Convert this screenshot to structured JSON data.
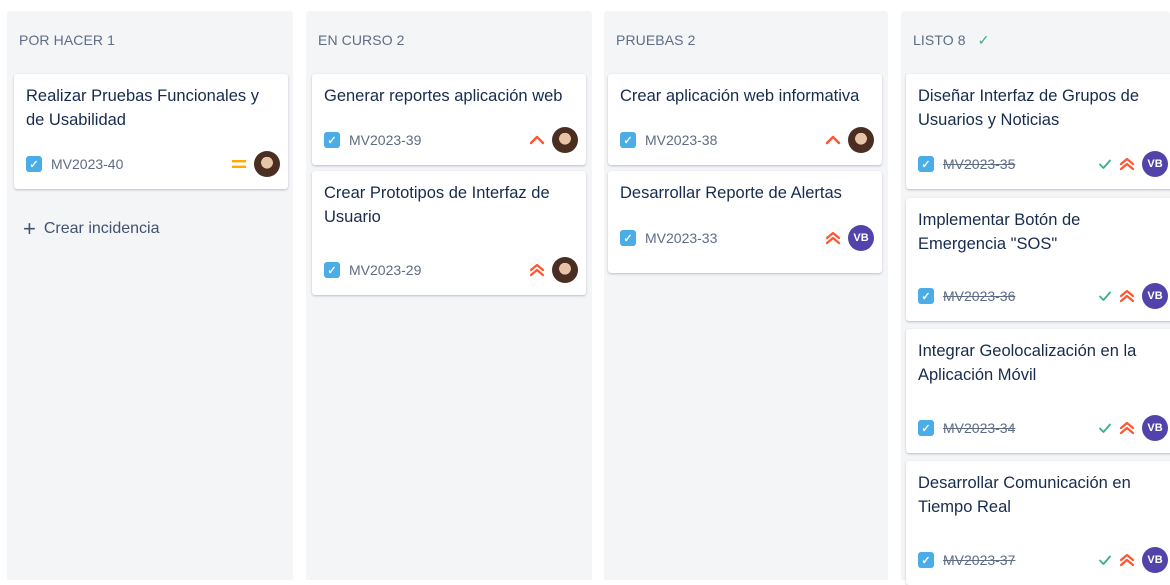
{
  "columns": [
    {
      "title": "POR HACER 1"
    },
    {
      "title": "EN CURSO 2"
    },
    {
      "title": "PRUEBAS 2"
    },
    {
      "title": "LISTO 8",
      "done_icon": "check-icon"
    }
  ],
  "create_issue": {
    "icon": "plus-icon",
    "label": "Crear incidencia"
  },
  "cards": {
    "todo": [
      {
        "title": "Realizar Pruebas Funcionales y de Usabilidad",
        "key": "MV2023-40",
        "priority": "medium",
        "assignee": "photo"
      }
    ],
    "in_progress": [
      {
        "title": "Generar reportes aplicación web",
        "key": "MV2023-39",
        "priority": "high",
        "assignee": "photo"
      },
      {
        "title": "Crear Prototipos de Interfaz de Usuario",
        "key": "MV2023-29",
        "priority": "highest",
        "assignee": "photo"
      }
    ],
    "testing": [
      {
        "title": "Crear aplicación web informativa",
        "key": "MV2023-38",
        "priority": "high",
        "assignee": "photo"
      },
      {
        "title": "Desarrollar Reporte de Alertas",
        "key": "MV2023-33",
        "priority": "highest",
        "assignee": "VB"
      }
    ],
    "done": [
      {
        "title": "Diseñar Interfaz de Grupos de Usuarios y Noticias",
        "key": "MV2023-35",
        "priority": "highest",
        "assignee": "VB"
      },
      {
        "title": "Implementar Botón de Emergencia \"SOS\"",
        "key": "MV2023-36",
        "priority": "highest",
        "assignee": "VB"
      },
      {
        "title": "Integrar Geolocalización en la Aplicación Móvil",
        "key": "MV2023-34",
        "priority": "highest",
        "assignee": "VB"
      },
      {
        "title": "Desarrollar Comunicación en Tiempo Real",
        "key": "MV2023-37",
        "priority": "highest",
        "assignee": "VB"
      }
    ]
  },
  "colors": {
    "story": "#4bade8",
    "priority_high": "#ff5630",
    "priority_medium": "#ffab00",
    "done_check": "#36b37e",
    "avatar_vb": "#5243aa"
  }
}
